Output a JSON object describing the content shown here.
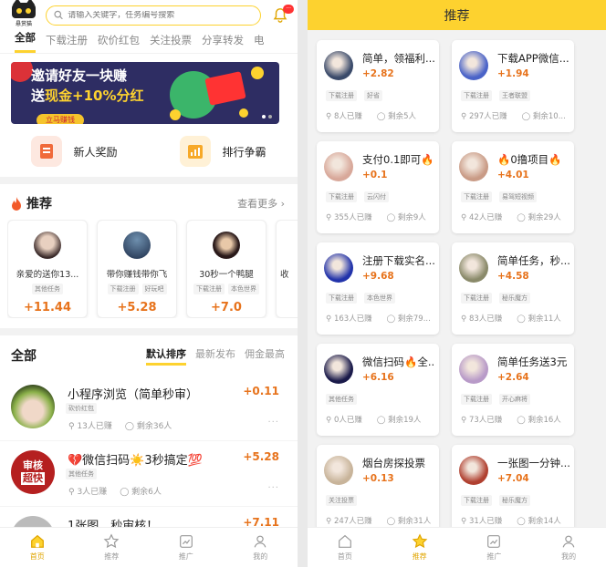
{
  "left": {
    "logo_text": "悬赏猫",
    "search_placeholder": "请输入关键字，任务编号搜索",
    "notif_badge": "···",
    "tabs": [
      "全部",
      "下载注册",
      "砍价红包",
      "关注投票",
      "分享转发",
      "电"
    ],
    "banner": {
      "line1": "邀请好友一块赚",
      "line2a": "送",
      "line2b": "现金+10%分红",
      "button": "立马赚钱"
    },
    "quick": [
      "新人奖励",
      "排行争霸"
    ],
    "recommend": {
      "title": "推荐",
      "more": "查看更多",
      "items": [
        {
          "name": "亲爱的送你13...",
          "tags": [
            "其他任务"
          ],
          "reward": "+11.44",
          "color": "#7a6a5f"
        },
        {
          "name": "带你赚钱带你飞",
          "tags": [
            "下载注册",
            "好玩吧"
          ],
          "reward": "+5.28",
          "color": "#2e4c6c"
        },
        {
          "name": "30秒一个鸭腿",
          "tags": [
            "下载注册",
            "本色世界"
          ],
          "reward": "+7.0",
          "color": "#6a4a2a"
        },
        {
          "name": "收",
          "tags": [
            "下"
          ],
          "reward": "",
          "color": "#ccc"
        }
      ]
    },
    "all": {
      "title": "全部",
      "sorts": [
        "默认排序",
        "最新发布",
        "佣金最高"
      ],
      "tasks": [
        {
          "title": "小程序浏览（简单秒审）",
          "tag": "砍价红包",
          "earned": "13人已赚",
          "left": "剩余36人",
          "reward": "+0.11",
          "color": "#8bb14a"
        },
        {
          "title": "💔微信扫码☀️3秒搞定💯",
          "tag": "其他任务",
          "earned": "3人已赚",
          "left": "剩余6人",
          "reward": "+5.28",
          "color": "#b52020",
          "badge1": "审核",
          "badge2": "超快"
        },
        {
          "title": "1张图，秒审核！",
          "tag": "",
          "earned": "",
          "left": "",
          "reward": "+7.11",
          "color": "#999"
        }
      ]
    }
  },
  "right": {
    "title": "推荐",
    "cards": [
      {
        "title": "简单，领福利...",
        "reward": "+2.82",
        "tags": [
          "下载注册",
          "好省"
        ],
        "earned": "8人已赚",
        "left": "剩余5人",
        "color": "#3a4a6a"
      },
      {
        "title": "下载APP微信...",
        "reward": "+1.94",
        "tags": [
          "下载注册",
          "王者联盟"
        ],
        "earned": "297人已赚",
        "left": "剩余10...",
        "color": "#4a63c8"
      },
      {
        "title": "支付0.1即可🔥",
        "reward": "+0.1",
        "tags": [
          "下载注册",
          "云闪付"
        ],
        "earned": "355人已赚",
        "left": "剩余9人",
        "color": "#d8a89a"
      },
      {
        "title": "🔥0撸项目🔥",
        "reward": "+4.01",
        "tags": [
          "下载注册",
          "易驾短视频"
        ],
        "earned": "42人已赚",
        "left": "剩余29人",
        "color": "#c99b86"
      },
      {
        "title": "注册下载实名...",
        "reward": "+9.68",
        "tags": [
          "下载注册",
          "本色世界"
        ],
        "earned": "163人已赚",
        "left": "剩余79...",
        "color": "#2233aa"
      },
      {
        "title": "简单任务，秒...",
        "reward": "+4.58",
        "tags": [
          "下载注册",
          "秘乐魔方"
        ],
        "earned": "83人已赚",
        "left": "剩余11人",
        "color": "#8a8a6a"
      },
      {
        "title": "微信扫码🔥全...",
        "reward": "+6.16",
        "tags": [
          "其他任务"
        ],
        "earned": "0人已赚",
        "left": "剩余19人",
        "color": "#1a1a4a"
      },
      {
        "title": "简单任务送3元",
        "reward": "+2.64",
        "tags": [
          "下载注册",
          "开心麻将"
        ],
        "earned": "73人已赚",
        "left": "剩余16人",
        "color": "#b89ac8"
      },
      {
        "title": "烟台房探投票",
        "reward": "+0.13",
        "tags": [
          "关注投票"
        ],
        "earned": "247人已赚",
        "left": "剩余31人",
        "color": "#c8b49a"
      },
      {
        "title": "一张图一分钟...",
        "reward": "+7.04",
        "tags": [
          "下载注册",
          "秘乐魔方"
        ],
        "earned": "31人已赚",
        "left": "剩余14人",
        "color": "#b04030"
      }
    ]
  },
  "nav": [
    {
      "label": "首页",
      "icon": "home-icon"
    },
    {
      "label": "推荐",
      "icon": "star-icon"
    },
    {
      "label": "推广",
      "icon": "chart-icon"
    },
    {
      "label": "我的",
      "icon": "user-icon"
    }
  ],
  "accent": "#fdd22f",
  "reward_color": "#e7731c"
}
